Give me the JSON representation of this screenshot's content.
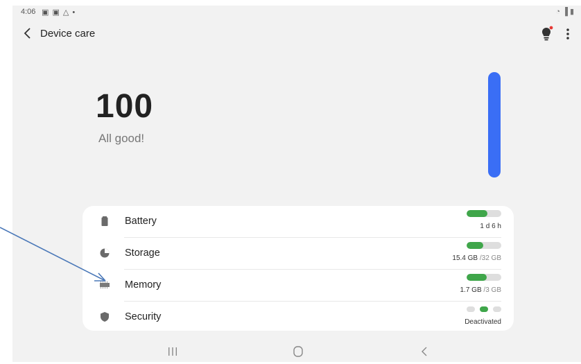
{
  "status_bar": {
    "time": "4:06",
    "icons": "▣ ▣ △ •",
    "right_icons": "◔ ▐ ▮"
  },
  "header": {
    "back_icon": "chevron-left-icon",
    "title": "Device care",
    "tips_icon": "lightbulb-icon",
    "more_icon": "more-vertical-icon"
  },
  "score": {
    "value": "100",
    "status": "All good!",
    "level_fraction": 1.0,
    "accent": "#3a6ef5"
  },
  "items": [
    {
      "label": "Battery",
      "icon": "battery-icon",
      "value": "1 d 6 h",
      "value_muted": "",
      "fraction": 0.6
    },
    {
      "label": "Storage",
      "icon": "storage-pie-icon",
      "value": "15.4 GB",
      "value_muted": " /32 GB",
      "fraction": 0.48
    },
    {
      "label": "Memory",
      "icon": "memory-chip-icon",
      "value": "1.7 GB",
      "value_muted": " /3 GB",
      "fraction": 0.57
    },
    {
      "label": "Security",
      "icon": "shield-icon",
      "value": "Deactivated",
      "value_muted": "",
      "state_index": 1
    }
  ],
  "nav": {
    "recents_icon": "recents-icon",
    "home_icon": "home-icon",
    "back_icon": "back-icon"
  },
  "colors": {
    "meter_fill": "#3fa64a",
    "meter_track": "#dedede",
    "background": "#f2f2f2",
    "annotation_arrow": "#4a78b8"
  }
}
